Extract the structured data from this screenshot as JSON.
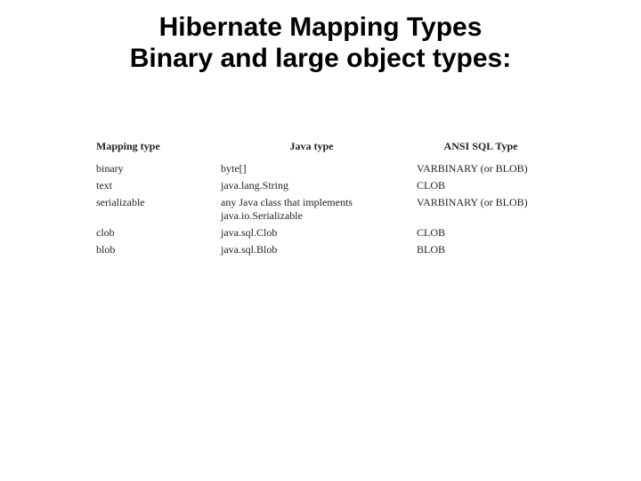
{
  "title": {
    "line1": "Hibernate Mapping Types",
    "line2": "Binary and large object types:"
  },
  "table": {
    "headers": {
      "mapping": "Mapping type",
      "java": "Java type",
      "sql": "ANSI SQL Type"
    },
    "rows": [
      {
        "mapping": "binary",
        "java": "byte[]",
        "sql": "VARBINARY (or BLOB)"
      },
      {
        "mapping": "text",
        "java": "java.lang.String",
        "sql": "CLOB"
      },
      {
        "mapping": "serializable",
        "java": "any Java class that implements java.io.Serializable",
        "sql": "VARBINARY (or BLOB)"
      },
      {
        "mapping": "clob",
        "java": "java.sql.Clob",
        "sql": "CLOB"
      },
      {
        "mapping": "blob",
        "java": "java.sql.Blob",
        "sql": "BLOB"
      }
    ]
  }
}
